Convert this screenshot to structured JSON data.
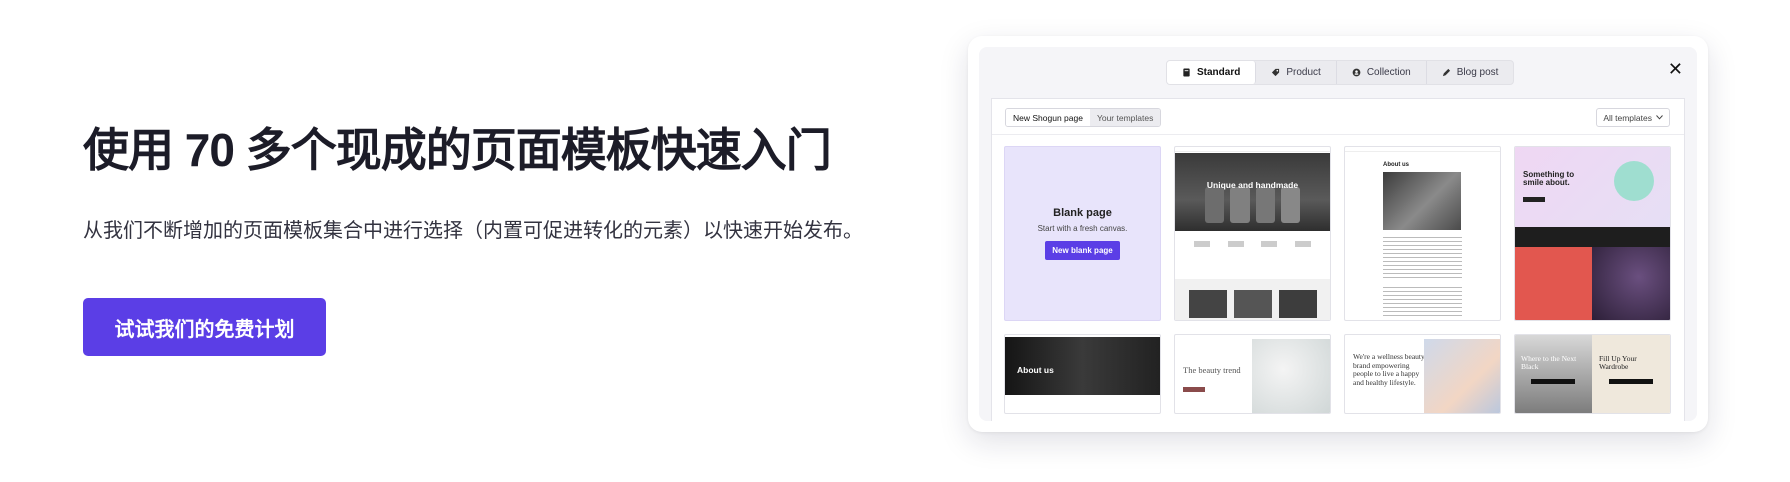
{
  "hero": {
    "title": "使用 70 多个现成的页面模板快速入门",
    "subtitle": "从我们不断增加的页面模板集合中进行选择（内置可促进转化的元素）以快速开始发布。",
    "cta_label": "试试我们的免费计划"
  },
  "modal": {
    "type_tabs": [
      {
        "label": "Standard",
        "icon": "document-icon",
        "active": true
      },
      {
        "label": "Product",
        "icon": "tag-icon",
        "active": false
      },
      {
        "label": "Collection",
        "icon": "collection-icon",
        "active": false
      },
      {
        "label": "Blog post",
        "icon": "pen-icon",
        "active": false
      }
    ],
    "close_icon": "close-icon",
    "source_tabs": [
      {
        "label": "New Shogun page",
        "active": true
      },
      {
        "label": "Your templates",
        "active": false
      }
    ],
    "filter_label": "All templates",
    "blank_card": {
      "title": "Blank page",
      "subtitle": "Start with a fresh canvas.",
      "button_label": "New blank page"
    },
    "templates": [
      {
        "headline": "Unique and handmade"
      },
      {
        "headline": "About us"
      },
      {
        "headline": "Something to smile about."
      },
      {
        "headline": "About us"
      },
      {
        "headline": "The beauty trend"
      },
      {
        "headline": "We're a wellness beauty brand empowering people to live a happy and healthy lifestyle."
      },
      {
        "headline": "Where to the Next Black",
        "headline_right": "Fill Up Your Wardrobe"
      }
    ]
  },
  "colors": {
    "accent": "#5b3ee6",
    "blank_card_bg": "#e8e4fb",
    "heading": "#1c1c28"
  }
}
